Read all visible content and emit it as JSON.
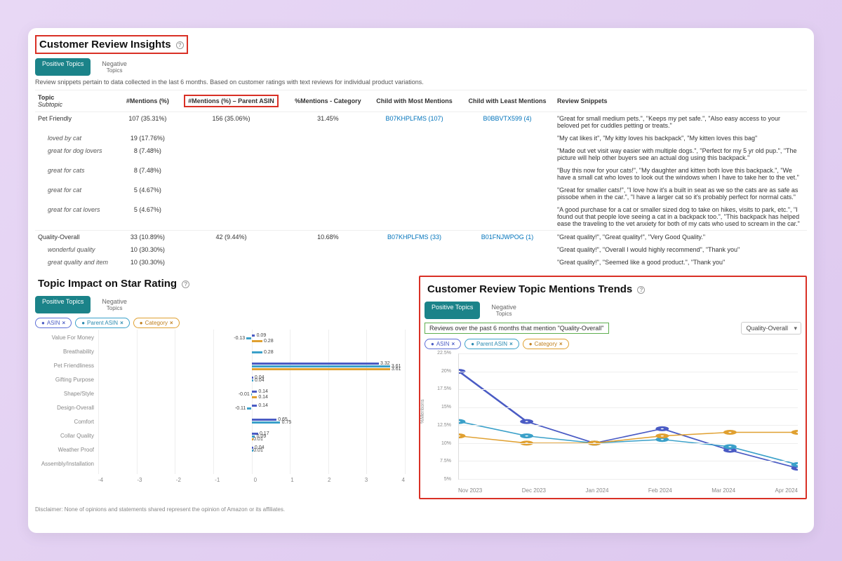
{
  "header": {
    "title": "Customer Review Insights"
  },
  "tabs": {
    "positive": "Positive Topics",
    "negative_l1": "Negative",
    "negative_l2": "Topics"
  },
  "note": "Review snippets pertain to data collected in the last 6 months. Based on customer ratings with text reviews for individual product variations.",
  "table": {
    "cols": {
      "topic": "Topic",
      "subtopic": "Subtopic",
      "mentions": "#Mentions (%)",
      "mentions_parent": "#Mentions (%) – Parent ASIN",
      "mentions_cat": "%Mentions - Category",
      "child_most": "Child with Most Mentions",
      "child_least": "Child with Least Mentions",
      "snippets": "Review Snippets"
    },
    "rows": [
      {
        "topic": "Pet Friendly",
        "mentions": "107 (35.31%)",
        "mparent": "156 (35.06%)",
        "mcat": "31.45%",
        "cmost": "B07KHPLFMS (107)",
        "cleast": "B0BBVTX599 (4)",
        "snip": "\"Great for small medium pets.\", \"Keeps my pet safe.\", \"Also easy access to your beloved pet for cuddles petting or treats.\""
      },
      {
        "sub": true,
        "topic": "loved by cat",
        "mentions": "19 (17.76%)",
        "snip": "\"My cat likes it\", \"My kitty loves his backpack\", \"My kitten loves this bag\""
      },
      {
        "sub": true,
        "topic": "great for dog lovers",
        "mentions": "8 (7.48%)",
        "snip": "\"Made out vet visit way easier with multiple dogs.\", \"Perfect for my 5 yr old pup.\", \"The picture will help other buyers see an actual dog using this backpack.\""
      },
      {
        "sub": true,
        "topic": "great for cats",
        "mentions": "8 (7.48%)",
        "snip": "\"Buy this now for your cats!\", \"My daughter and kitten both love this backpack.\", \"We have a small cat who loves to look out the windows when I have to take her to the vet.\""
      },
      {
        "sub": true,
        "topic": "great for cat",
        "mentions": "5 (4.67%)",
        "snip": "\"Great for smaller cats!\", \"I love how it's a built in seat as we so the cats are as safe as pissobe when in the car.\", \"I have a larger cat so it's probably perfect for normal cats.\""
      },
      {
        "sub": true,
        "topic": "great for cat lovers",
        "mentions": "5 (4.67%)",
        "snip": "\"A good purchase for a cat or smaller sized dog to take on hikes, visits to park, etc.\", \"I found out that people love seeing a cat in a backpack too.\", \"This backpack has helped ease the traveling to the vet anxiety for both of my cats who used to scream in the car.\""
      },
      {
        "topic": "Quality-Overall",
        "mentions": "33 (10.89%)",
        "mparent": "42 (9.44%)",
        "mcat": "10.68%",
        "cmost": "B07KHPLFMS (33)",
        "cleast": "B01FNJWPOG (1)",
        "snip": "\"Great quality!\", \"Great quality!\", \"Very Good Quality.\""
      },
      {
        "sub": true,
        "topic": "wonderful quality",
        "mentions": "10 (30.30%)",
        "snip": "\"Great quality!\", \"Overall I would highly recommend\", \"Thank you\""
      },
      {
        "sub": true,
        "topic": "great quality and item",
        "mentions": "10 (30.30%)",
        "snip": "\"Great quality!\", \"Seemed like a good product.\", \"Thank you\""
      }
    ]
  },
  "impact": {
    "title": "Topic Impact on Star Rating",
    "chips": {
      "asin": "ASIN",
      "parent": "Parent ASIN",
      "category": "Category"
    },
    "xmin": -4,
    "xmax": 4,
    "topics": [
      {
        "name": "Value For Money",
        "asin": 0.09,
        "par": -0.13,
        "cat": 0.28
      },
      {
        "name": "Breathability",
        "asin": null,
        "par": 0.28,
        "cat": null
      },
      {
        "name": "Pet Friendliness",
        "asin": 3.32,
        "par": 3.61,
        "cat": 3.61
      },
      {
        "name": "Gifting Purpose",
        "asin": 0.04,
        "par": 0.04,
        "cat": null
      },
      {
        "name": "Shape/Style",
        "asin": 0.14,
        "par": -0.01,
        "cat": 0.14
      },
      {
        "name": "Design-Overall",
        "asin": 0.14,
        "par": -0.11,
        "cat": null
      },
      {
        "name": "Comfort",
        "asin": 0.65,
        "par": 0.75,
        "cat": null
      },
      {
        "name": "Collar Quality",
        "asin": 0.17,
        "par": 0.09,
        "cat": 0.01
      },
      {
        "name": "Weather Proof",
        "asin": 0.04,
        "par": 0.01,
        "cat": null
      },
      {
        "name": "Assembly/Installation",
        "asin": null,
        "par": null,
        "cat": null
      }
    ],
    "xticks": [
      "-4",
      "-3",
      "-2",
      "-1",
      "0",
      "1",
      "2",
      "3",
      "4"
    ]
  },
  "trends": {
    "title": "Customer Review Topic Mentions Trends",
    "filter_note": "Reviews over the past 6 months that mention \"Quality-Overall\"",
    "dropdown": "Quality-Overall",
    "ylabel": "%Mentions",
    "yticks": [
      "5%",
      "7.5%",
      "10%",
      "12.5%",
      "15%",
      "17.5%",
      "20%",
      "22.5%"
    ],
    "xticks": [
      "Nov 2023",
      "Dec 2023",
      "Jan 2024",
      "Feb 2024",
      "Mar 2024",
      "Apr 2024"
    ]
  },
  "chart_data": [
    {
      "type": "bar",
      "title": "Topic Impact on Star Rating",
      "orientation": "horizontal",
      "xlabel": "",
      "ylabel": "",
      "xlim": [
        -4,
        4
      ],
      "categories": [
        "Value For Money",
        "Breathability",
        "Pet Friendliness",
        "Gifting Purpose",
        "Shape/Style",
        "Design-Overall",
        "Comfort",
        "Collar Quality",
        "Weather Proof",
        "Assembly/Installation"
      ],
      "series": [
        {
          "name": "ASIN",
          "values": [
            0.09,
            null,
            3.32,
            0.04,
            0.14,
            0.14,
            0.65,
            0.17,
            0.04,
            null
          ]
        },
        {
          "name": "Parent ASIN",
          "values": [
            -0.13,
            0.28,
            3.61,
            0.04,
            -0.01,
            -0.11,
            0.75,
            0.09,
            0.01,
            null
          ]
        },
        {
          "name": "Category",
          "values": [
            0.28,
            null,
            3.61,
            null,
            0.14,
            null,
            null,
            0.01,
            null,
            null
          ]
        }
      ]
    },
    {
      "type": "line",
      "title": "Customer Review Topic Mentions Trends",
      "xlabel": "",
      "ylabel": "%Mentions",
      "ylim": [
        5,
        22.5
      ],
      "x": [
        "Nov 2023",
        "Dec 2023",
        "Jan 2024",
        "Feb 2024",
        "Mar 2024",
        "Apr 2024"
      ],
      "series": [
        {
          "name": "ASIN",
          "values": [
            20.0,
            13.0,
            10.0,
            12.0,
            9.0,
            6.5
          ]
        },
        {
          "name": "Parent ASIN",
          "values": [
            13.0,
            11.0,
            10.0,
            10.5,
            9.5,
            7.0
          ]
        },
        {
          "name": "Category",
          "values": [
            11.0,
            10.0,
            10.0,
            11.0,
            11.5,
            11.5
          ]
        }
      ]
    }
  ],
  "disclaimer": "Disclaimer: None of opinions and statements shared represent the opinion of Amazon or its affiliates."
}
